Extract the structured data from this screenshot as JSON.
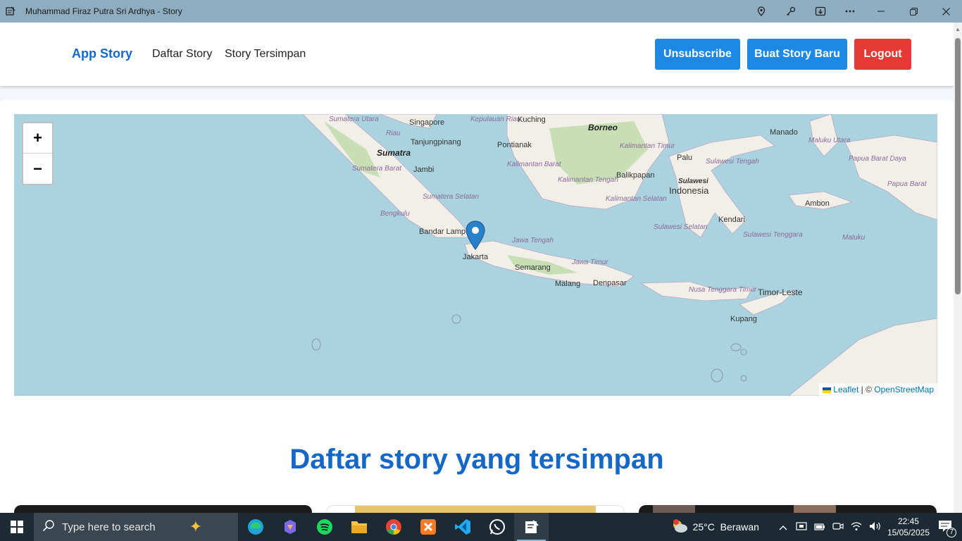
{
  "window": {
    "title": "Muhammad Firaz Putra Sri Ardhya - Story"
  },
  "navbar": {
    "brand": "App Story",
    "links": [
      "Daftar Story",
      "Story Tersimpan"
    ],
    "buttons": {
      "unsubscribe": "Unsubscribe",
      "create": "Buat Story Baru",
      "logout": "Logout"
    },
    "colors": {
      "primary": "#1e88e5",
      "danger": "#e53935",
      "brand": "#1668c7"
    }
  },
  "map": {
    "zoom_in": "+",
    "zoom_out": "−",
    "attribution": {
      "leaflet": "Leaflet",
      "sep": "| ©",
      "osm": "OpenStreetMap"
    },
    "labels": {
      "singapore": "Singapore",
      "tanjungpinang": "Tanjungpinang",
      "kuching": "Kuching",
      "borneo": "Borneo",
      "manado": "Manado",
      "sumatra": "Sumatra",
      "jambi": "Jambi",
      "pontianak": "Pontianak",
      "palu": "Palu",
      "balikpapan": "Balikpapan",
      "sulawesi": "Sulawesi",
      "indonesia": "Indonesia",
      "ambon": "Ambon",
      "bandar_lampung": "Bandar Lamp",
      "jakarta": "Jakarta",
      "semarang": "Semarang",
      "malang": "Malang",
      "denpasar": "Denpasar",
      "kendari": "Kendari",
      "timor_leste": "Timor-Leste",
      "kupang": "Kupang",
      "bengkulu": "Bengkulu",
      "sumatera_utara": "Sumatera Utara",
      "riau": "Riau",
      "kepulauan_riau": "Kepulauan Riau",
      "sumatera_barat": "Sumatera Barat",
      "sumatera_selatan": "Sumatera Selatan",
      "kalimantan_barat": "Kalimantan Barat",
      "kalimantan_timur": "Kalimantan Timur",
      "kalimantan_tengah": "Kalimantan Tengah",
      "kalimantan_selatan": "Kalimantan Selatan",
      "sulawesi_tengah": "Sulawesi Tengah",
      "sulawesi_selatan": "Sulawesi Selatan",
      "sulawesi_tenggara": "Sulawesi Tenggara",
      "jawa_tengah": "Jawa Tengah",
      "jawa_timur": "Jawa Timur",
      "nusa_tenggara_timur": "Nusa Tenggara Timur",
      "maluku_utara": "Maluku Utara",
      "papua_barat_daya": "Papua Barat Daya",
      "papua_barat": "Papua Barat",
      "maluku": "Maluku"
    },
    "colors": {
      "sea": "#aad3df",
      "land": "#f2efe9",
      "forest": "#c8dfb5"
    }
  },
  "section": {
    "title": "Daftar story yang tersimpan"
  },
  "taskbar": {
    "search_placeholder": "Type here to search",
    "weather": "25°C  Berawan",
    "time": "22:45",
    "date": "15/05/2025",
    "notification_count": "7"
  }
}
